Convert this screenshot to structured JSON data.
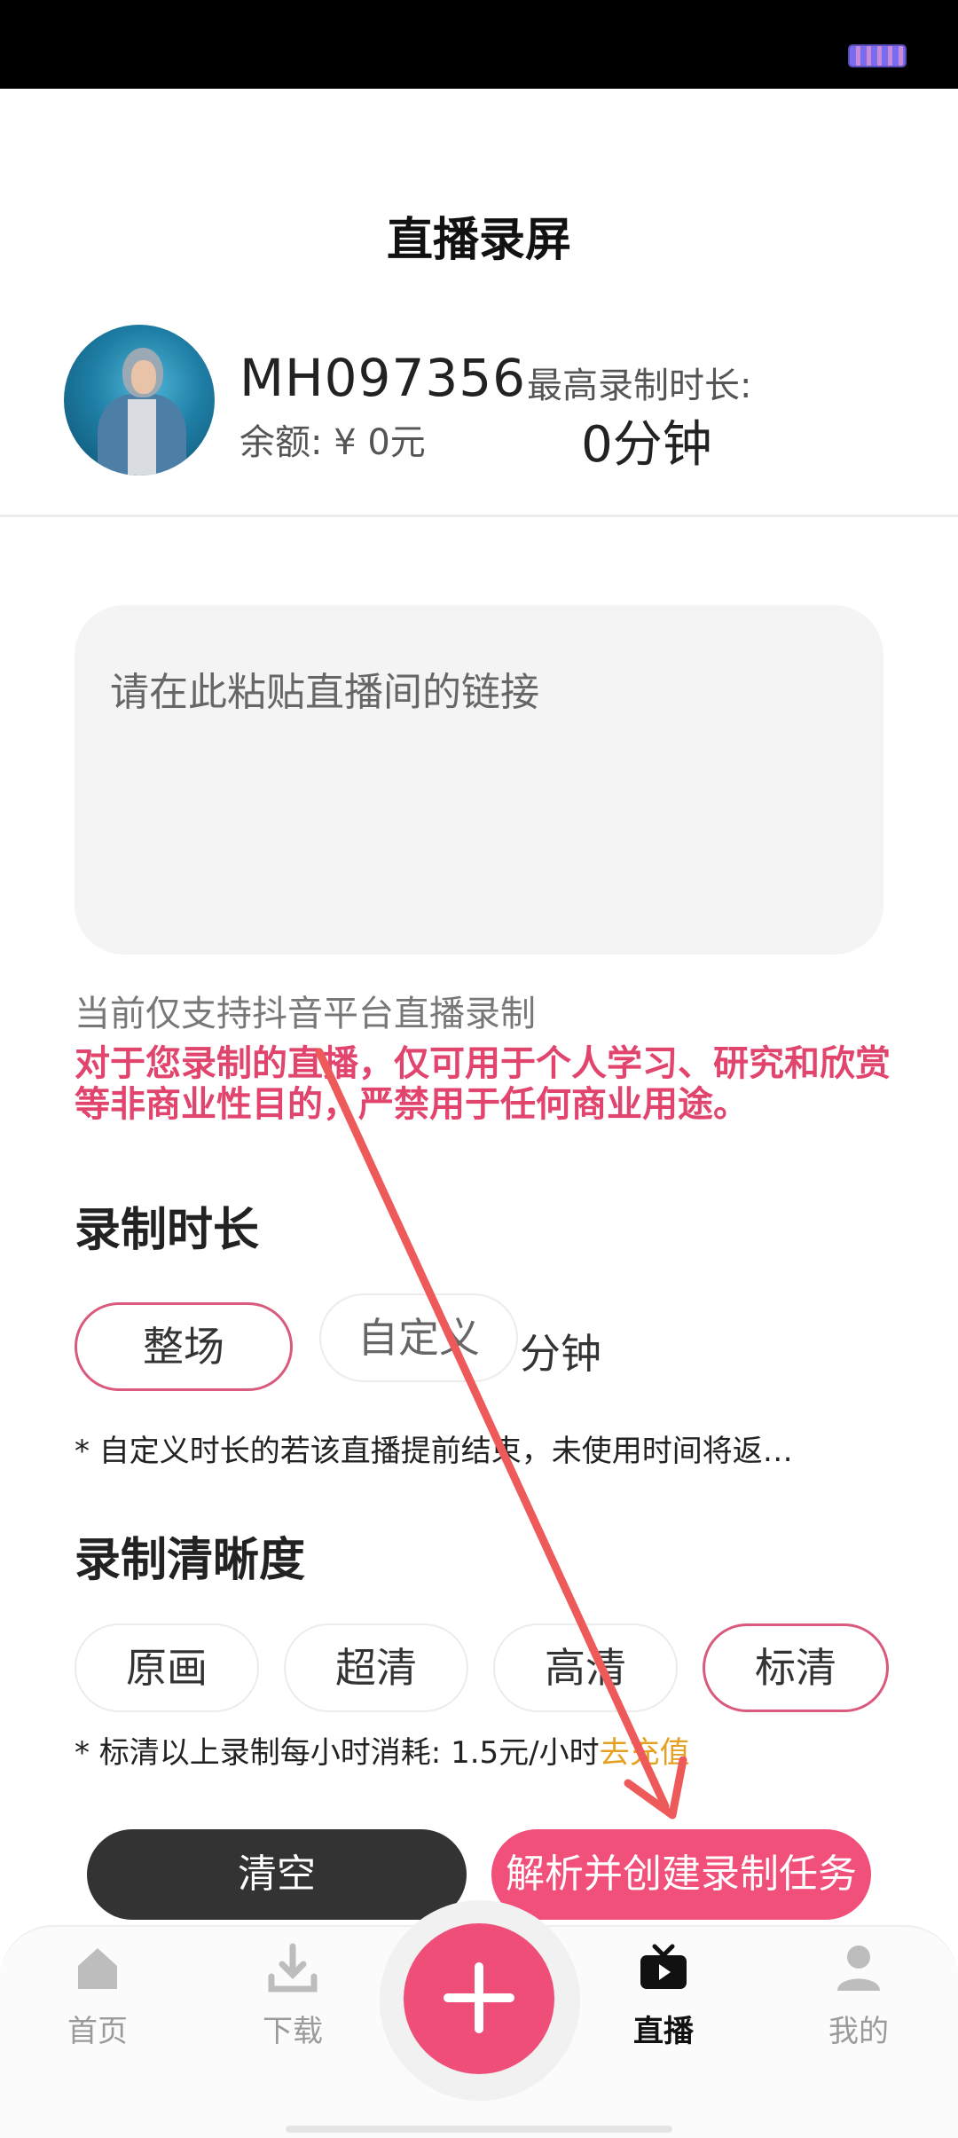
{
  "page": {
    "title": "直播录屏"
  },
  "profile": {
    "username": "MH097356",
    "balance": "余额: ¥ 0元",
    "max_label": "最高录制时长:",
    "max_value": "0分钟"
  },
  "link_input": {
    "placeholder": "请在此粘贴直播间的链接",
    "value": ""
  },
  "support_text": "当前仅支持抖音平台直播录制",
  "warning_text": "对于您录制的直播，仅可用于个人学习、研究和欣赏等非商业性目的，严禁用于任何商业用途。",
  "duration": {
    "title": "录制时长",
    "full_label": "整场",
    "custom_placeholder": "自定义",
    "unit": "分钟",
    "selected": "整场",
    "note": "* 自定义时长的若该直播提前结束，未使用时间将返…"
  },
  "quality": {
    "title": "录制清晰度",
    "options": [
      "原画",
      "超清",
      "高清",
      "标清"
    ],
    "selected": "标清",
    "note": "* 标清以上录制每小时消耗: 1.5元/小时",
    "recharge_link": "去充值"
  },
  "actions": {
    "clear": "清空",
    "create": "解析并创建录制任务"
  },
  "tabbar": {
    "items": [
      {
        "label": "首页",
        "icon": "home-icon"
      },
      {
        "label": "下载",
        "icon": "download-icon"
      },
      {
        "label": "直播",
        "icon": "tv-icon"
      },
      {
        "label": "我的",
        "icon": "user-icon"
      }
    ],
    "active": "直播",
    "center_icon": "plus-icon"
  },
  "colors": {
    "accent": "#f0507a",
    "warning": "#e1456d",
    "recharge": "#e6a020",
    "dark_button": "#333333"
  }
}
